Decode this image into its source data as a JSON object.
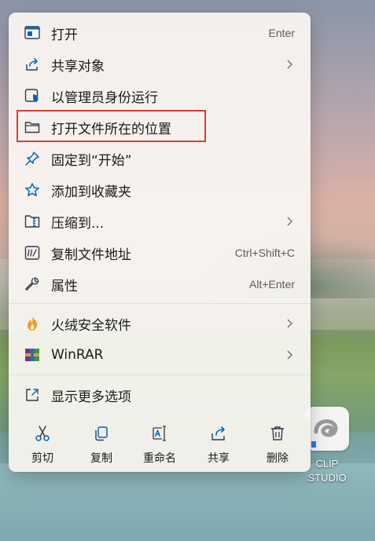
{
  "menu": {
    "items": [
      {
        "label": "打开",
        "shortcut": "Enter",
        "icon": "window-open-icon"
      },
      {
        "label": "共享对象",
        "icon": "share-arrow-icon",
        "submenu": true
      },
      {
        "label": "以管理员身份运行",
        "icon": "admin-shield-icon"
      },
      {
        "label": "打开文件所在的位置",
        "icon": "folder-icon",
        "highlighted": true
      },
      {
        "label": "固定到“开始”",
        "icon": "pin-icon"
      },
      {
        "label": "添加到收藏夹",
        "icon": "star-icon"
      },
      {
        "label": "压缩到...",
        "icon": "zip-folder-icon",
        "submenu": true
      },
      {
        "label": "复制文件地址",
        "shortcut": "Ctrl+Shift+C",
        "icon": "copy-path-icon"
      },
      {
        "label": "属性",
        "shortcut": "Alt+Enter",
        "icon": "wrench-icon"
      },
      {
        "label": "火绒安全软件",
        "icon": "huorong-flame-icon",
        "submenu": true
      },
      {
        "label": "WinRAR",
        "icon": "winrar-icon",
        "submenu": true
      },
      {
        "label": "显示更多选项",
        "icon": "more-options-icon"
      }
    ],
    "actions": [
      {
        "label": "剪切",
        "icon": "scissors-icon"
      },
      {
        "label": "复制",
        "icon": "copy-icon"
      },
      {
        "label": "重命名",
        "icon": "rename-icon"
      },
      {
        "label": "共享",
        "icon": "share-icon"
      },
      {
        "label": "删除",
        "icon": "trash-icon"
      }
    ]
  },
  "desktop": {
    "icon_label_line1": "CLIP",
    "icon_label_line2": "STUDIO",
    "icon": "clip-studio-icon"
  },
  "colors": {
    "highlight_border": "#e53935",
    "accent_blue": "#0067c0",
    "menu_background": "#faf6f3"
  }
}
